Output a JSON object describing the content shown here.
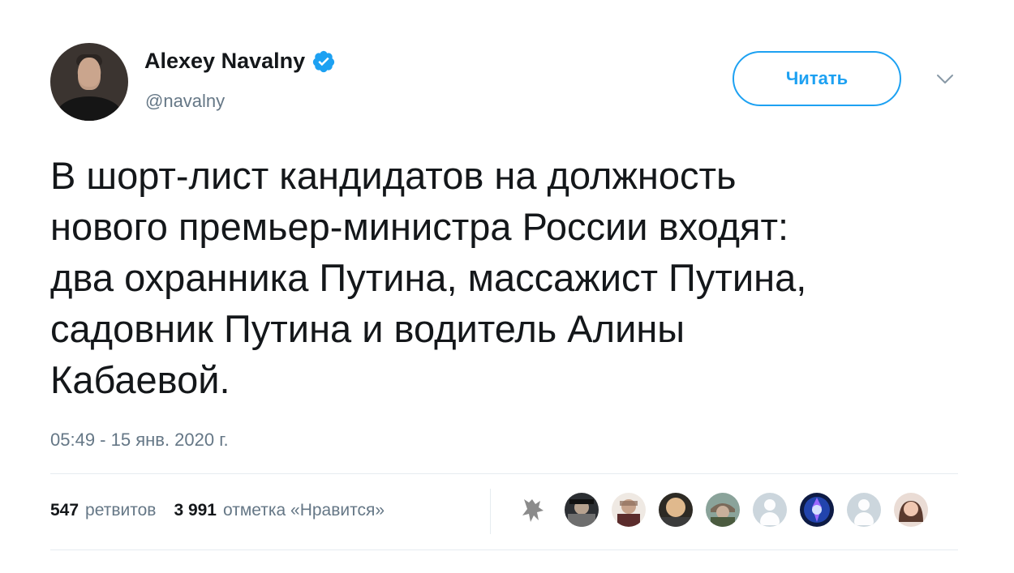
{
  "profile": {
    "display_name": "Alexey Navalny",
    "handle": "@navalny",
    "verified": true
  },
  "actions": {
    "follow_label": "Читать",
    "menu_icon": "chevron-down-icon"
  },
  "tweet": {
    "text": "В шорт-лист кандидатов на должность\nнового премьер-министра России входят:\nдва охранника Путина, массажист Путина,\nсадовник Путина и водитель Алины\nКабаевой.",
    "timestamp": "05:49 - 15 янв. 2020 г."
  },
  "stats": {
    "retweets_count": "547",
    "retweets_label": "ретвитов",
    "likes_count": "3 991",
    "likes_label": "отметка «Нравится»"
  },
  "colors": {
    "accent": "#1da1f2",
    "secondary_text": "#657786",
    "primary_text": "#14171a",
    "divider": "#e6ecf0"
  }
}
